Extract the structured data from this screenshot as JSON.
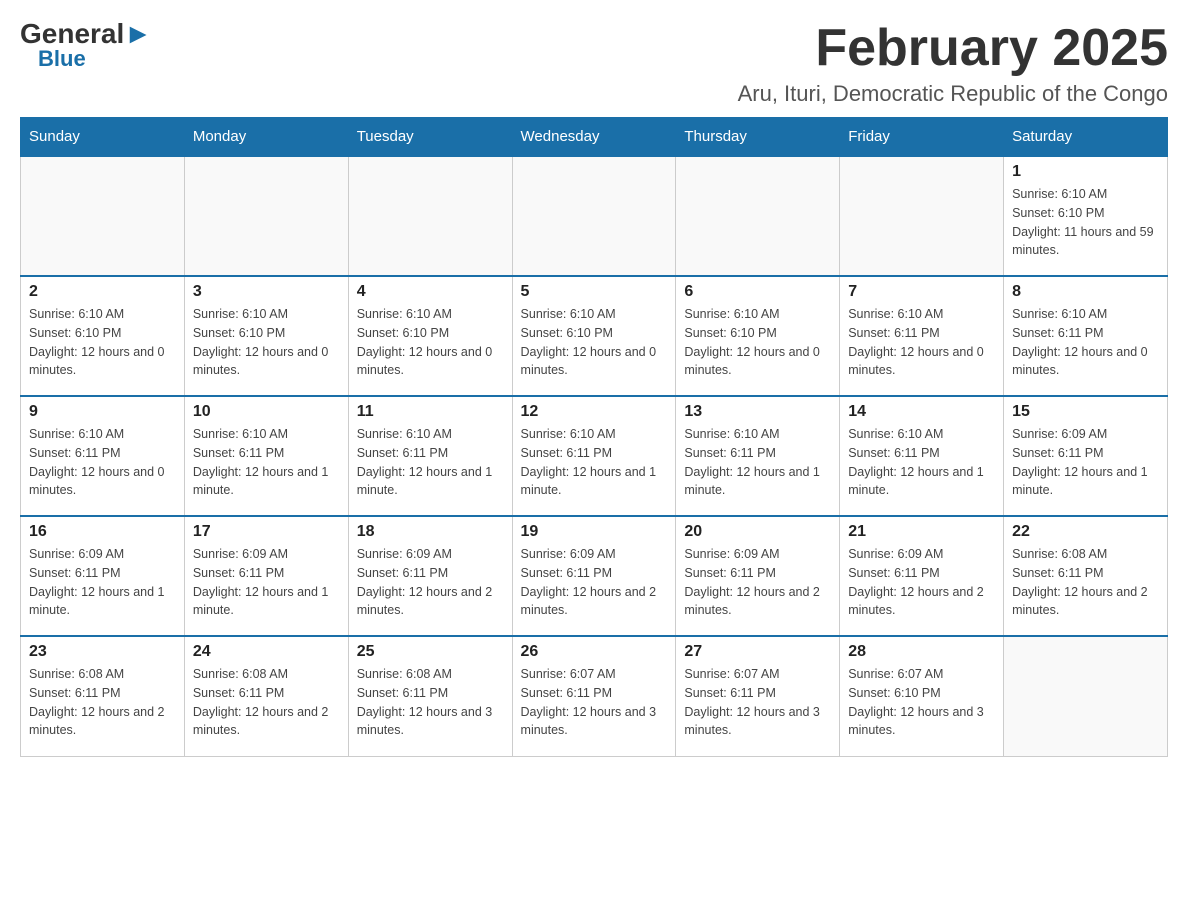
{
  "header": {
    "logo_general": "General",
    "logo_blue": "Blue",
    "month_title": "February 2025",
    "location": "Aru, Ituri, Democratic Republic of the Congo"
  },
  "days_of_week": [
    "Sunday",
    "Monday",
    "Tuesday",
    "Wednesday",
    "Thursday",
    "Friday",
    "Saturday"
  ],
  "weeks": [
    [
      {
        "day": "",
        "info": ""
      },
      {
        "day": "",
        "info": ""
      },
      {
        "day": "",
        "info": ""
      },
      {
        "day": "",
        "info": ""
      },
      {
        "day": "",
        "info": ""
      },
      {
        "day": "",
        "info": ""
      },
      {
        "day": "1",
        "info": "Sunrise: 6:10 AM\nSunset: 6:10 PM\nDaylight: 11 hours and 59 minutes."
      }
    ],
    [
      {
        "day": "2",
        "info": "Sunrise: 6:10 AM\nSunset: 6:10 PM\nDaylight: 12 hours and 0 minutes."
      },
      {
        "day": "3",
        "info": "Sunrise: 6:10 AM\nSunset: 6:10 PM\nDaylight: 12 hours and 0 minutes."
      },
      {
        "day": "4",
        "info": "Sunrise: 6:10 AM\nSunset: 6:10 PM\nDaylight: 12 hours and 0 minutes."
      },
      {
        "day": "5",
        "info": "Sunrise: 6:10 AM\nSunset: 6:10 PM\nDaylight: 12 hours and 0 minutes."
      },
      {
        "day": "6",
        "info": "Sunrise: 6:10 AM\nSunset: 6:10 PM\nDaylight: 12 hours and 0 minutes."
      },
      {
        "day": "7",
        "info": "Sunrise: 6:10 AM\nSunset: 6:11 PM\nDaylight: 12 hours and 0 minutes."
      },
      {
        "day": "8",
        "info": "Sunrise: 6:10 AM\nSunset: 6:11 PM\nDaylight: 12 hours and 0 minutes."
      }
    ],
    [
      {
        "day": "9",
        "info": "Sunrise: 6:10 AM\nSunset: 6:11 PM\nDaylight: 12 hours and 0 minutes."
      },
      {
        "day": "10",
        "info": "Sunrise: 6:10 AM\nSunset: 6:11 PM\nDaylight: 12 hours and 1 minute."
      },
      {
        "day": "11",
        "info": "Sunrise: 6:10 AM\nSunset: 6:11 PM\nDaylight: 12 hours and 1 minute."
      },
      {
        "day": "12",
        "info": "Sunrise: 6:10 AM\nSunset: 6:11 PM\nDaylight: 12 hours and 1 minute."
      },
      {
        "day": "13",
        "info": "Sunrise: 6:10 AM\nSunset: 6:11 PM\nDaylight: 12 hours and 1 minute."
      },
      {
        "day": "14",
        "info": "Sunrise: 6:10 AM\nSunset: 6:11 PM\nDaylight: 12 hours and 1 minute."
      },
      {
        "day": "15",
        "info": "Sunrise: 6:09 AM\nSunset: 6:11 PM\nDaylight: 12 hours and 1 minute."
      }
    ],
    [
      {
        "day": "16",
        "info": "Sunrise: 6:09 AM\nSunset: 6:11 PM\nDaylight: 12 hours and 1 minute."
      },
      {
        "day": "17",
        "info": "Sunrise: 6:09 AM\nSunset: 6:11 PM\nDaylight: 12 hours and 1 minute."
      },
      {
        "day": "18",
        "info": "Sunrise: 6:09 AM\nSunset: 6:11 PM\nDaylight: 12 hours and 2 minutes."
      },
      {
        "day": "19",
        "info": "Sunrise: 6:09 AM\nSunset: 6:11 PM\nDaylight: 12 hours and 2 minutes."
      },
      {
        "day": "20",
        "info": "Sunrise: 6:09 AM\nSunset: 6:11 PM\nDaylight: 12 hours and 2 minutes."
      },
      {
        "day": "21",
        "info": "Sunrise: 6:09 AM\nSunset: 6:11 PM\nDaylight: 12 hours and 2 minutes."
      },
      {
        "day": "22",
        "info": "Sunrise: 6:08 AM\nSunset: 6:11 PM\nDaylight: 12 hours and 2 minutes."
      }
    ],
    [
      {
        "day": "23",
        "info": "Sunrise: 6:08 AM\nSunset: 6:11 PM\nDaylight: 12 hours and 2 minutes."
      },
      {
        "day": "24",
        "info": "Sunrise: 6:08 AM\nSunset: 6:11 PM\nDaylight: 12 hours and 2 minutes."
      },
      {
        "day": "25",
        "info": "Sunrise: 6:08 AM\nSunset: 6:11 PM\nDaylight: 12 hours and 3 minutes."
      },
      {
        "day": "26",
        "info": "Sunrise: 6:07 AM\nSunset: 6:11 PM\nDaylight: 12 hours and 3 minutes."
      },
      {
        "day": "27",
        "info": "Sunrise: 6:07 AM\nSunset: 6:11 PM\nDaylight: 12 hours and 3 minutes."
      },
      {
        "day": "28",
        "info": "Sunrise: 6:07 AM\nSunset: 6:10 PM\nDaylight: 12 hours and 3 minutes."
      },
      {
        "day": "",
        "info": ""
      }
    ]
  ]
}
